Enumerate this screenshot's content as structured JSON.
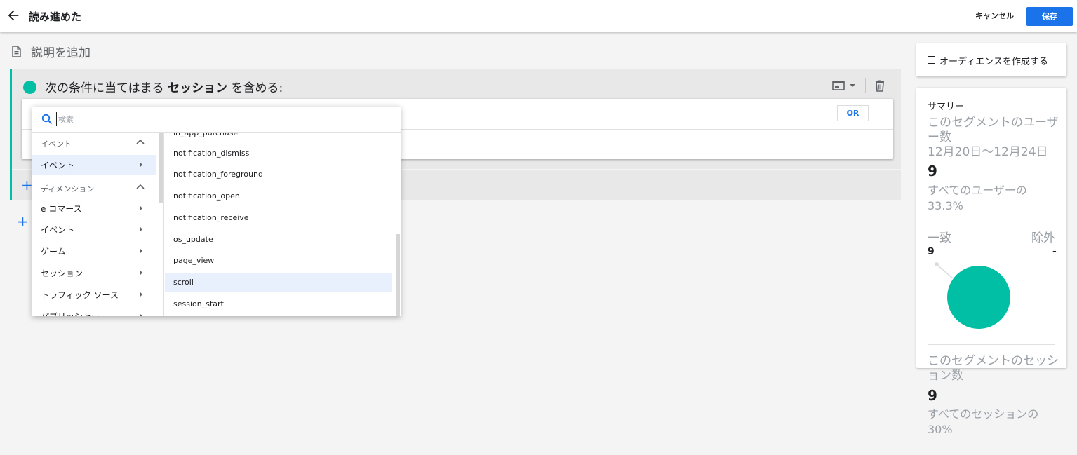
{
  "header": {
    "title": "読み進めた",
    "cancel_label": "キャンセル",
    "save_label": "保存",
    "colors": {
      "save_bg": "#1a73e8"
    }
  },
  "description": {
    "label": "説明を追加"
  },
  "condition": {
    "title_prefix": "次の条件に当てはまる",
    "title_bold": "セッション",
    "title_suffix": "を含める:",
    "or_label": "OR",
    "accent_color": "#00bfa5"
  },
  "dropdown": {
    "search_placeholder": "検索",
    "left": {
      "section1_header": "イベント",
      "section1_item": "イベント",
      "section2_header": "ディメンション",
      "items": [
        "e コマース",
        "イベント",
        "ゲーム",
        "セッション",
        "トラフィック ソース",
        "パブリッシャー"
      ]
    },
    "right": {
      "items": [
        "in_app_purchase",
        "notification_dismiss",
        "notification_foreground",
        "notification_open",
        "notification_receive",
        "os_update",
        "page_view",
        "scroll",
        "session_start"
      ],
      "selected": "scroll"
    }
  },
  "audience": {
    "label": "オーディエンスを作成する"
  },
  "summary": {
    "title": "サマリー",
    "users_label": "このセグメントのユーザー数",
    "date_range": "12月20日〜12月24日",
    "users_value": "9",
    "users_pct": "すべてのユーザーの 33.3%",
    "match_label": "一致",
    "exclude_label": "除外",
    "match_value": "9",
    "exclude_value": "-",
    "sessions_label": "このセグメントのセッション数",
    "sessions_value": "9",
    "sessions_pct": "すべてのセッションの 30%"
  }
}
